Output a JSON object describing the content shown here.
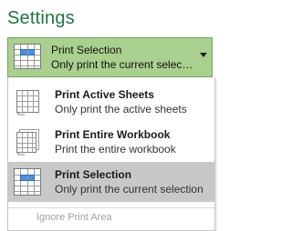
{
  "header": {
    "title": "Settings"
  },
  "selected": {
    "title": "Print Selection",
    "subtitle": "Only print the current selecti...",
    "icon": "print-selection-icon"
  },
  "options": [
    {
      "title": "Print Active Sheets",
      "subtitle": "Only print the active sheets",
      "icon": "active-sheets-icon",
      "selected": false
    },
    {
      "title": "Print Entire Workbook",
      "subtitle": "Print the entire workbook",
      "icon": "entire-workbook-icon",
      "selected": false
    },
    {
      "title": "Print Selection",
      "subtitle": "Only print the current selection",
      "icon": "print-selection-icon",
      "selected": true
    }
  ],
  "footer": {
    "ignore_label": "Ignore Print Area"
  },
  "colors": {
    "accent": "#217346",
    "selected_box": "#a9d08e",
    "selected_option": "#c8c8c8",
    "disabled_text": "#a0a0a0"
  }
}
